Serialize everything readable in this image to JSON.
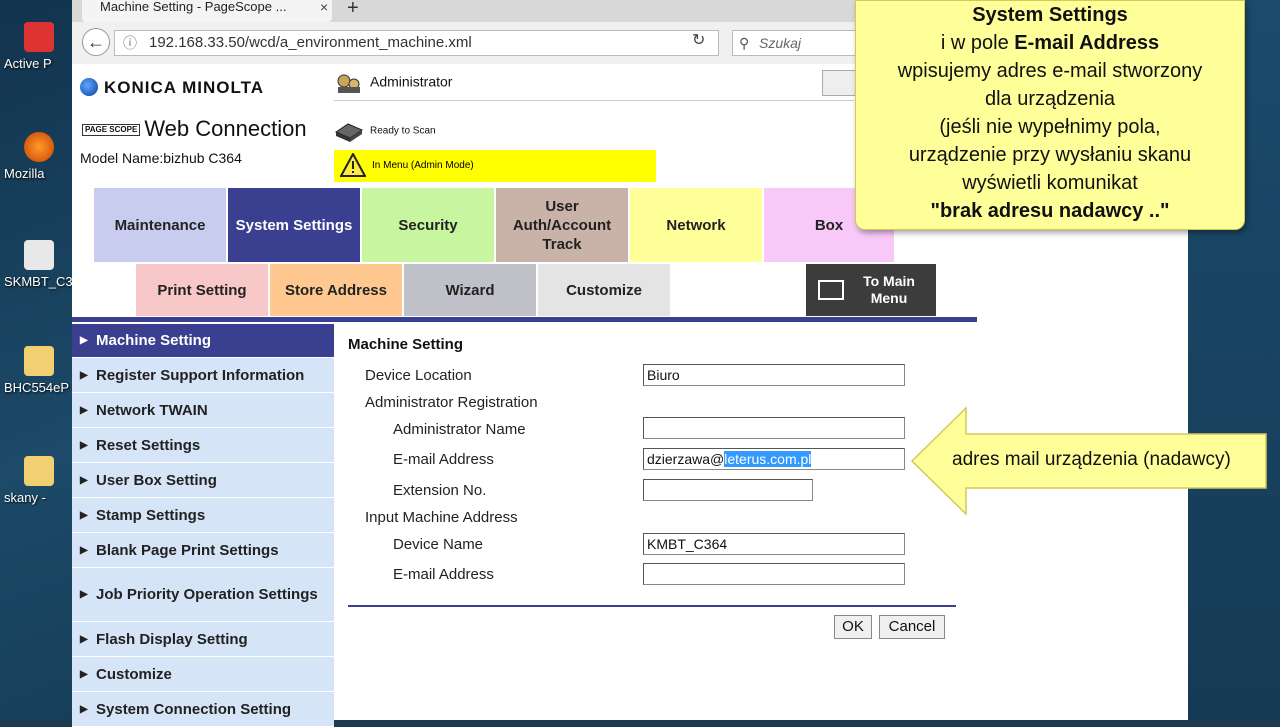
{
  "browser": {
    "tab_title": "Machine Setting - PageScope ...",
    "tab_close": "×",
    "new_tab": "+",
    "url": "192.168.33.50/wcd/a_environment_machine.xml",
    "search_placeholder": "Szukaj"
  },
  "desktop": {
    "icons": [
      {
        "label": "Active P"
      },
      {
        "label": "Mozilla"
      },
      {
        "label": "SKMBT_C3"
      },
      {
        "label": "BHC554eP"
      },
      {
        "label": "skany -"
      }
    ]
  },
  "header": {
    "brand": "KONICA MINOLTA",
    "pagescope": "PAGE SCOPE",
    "product": "Web Connection",
    "model": "Model Name:bizhub C364",
    "user": "Administrator",
    "scan_status": "Ready to Scan",
    "mode_status": "In Menu (Admin Mode)"
  },
  "main_tabs": [
    {
      "label": "Maintenance"
    },
    {
      "label": "System Settings"
    },
    {
      "label": "Security"
    },
    {
      "label": "User Auth/Account Track"
    },
    {
      "label": "Network"
    },
    {
      "label": "Box"
    }
  ],
  "sub_tabs": [
    {
      "label": "Print Setting"
    },
    {
      "label": "Store Address"
    },
    {
      "label": "Wizard"
    },
    {
      "label": "Customize"
    },
    {
      "label": "To Main Menu"
    }
  ],
  "left_menu": [
    {
      "label": "Machine Setting"
    },
    {
      "label": "Register Support Information"
    },
    {
      "label": "Network TWAIN"
    },
    {
      "label": "Reset Settings"
    },
    {
      "label": "User Box Setting"
    },
    {
      "label": "Stamp Settings"
    },
    {
      "label": "Blank Page Print Settings"
    },
    {
      "label": "Job Priority Operation Settings"
    },
    {
      "label": "Flash Display Setting"
    },
    {
      "label": "Customize"
    },
    {
      "label": "System Connection Setting"
    }
  ],
  "form": {
    "title": "Machine Setting",
    "device_location_label": "Device Location",
    "device_location_value": "Biuro",
    "admin_registration_label": "Administrator Registration",
    "admin_name_label": "Administrator Name",
    "admin_name_value": "",
    "email_label": "E-mail Address",
    "email_value_prefix": "dzierzawa@",
    "email_value_selected": "leterus.com.pl",
    "extension_label": "Extension No.",
    "extension_value": "",
    "input_machine_label": "Input Machine Address",
    "device_name_label": "Device Name",
    "device_name_value": "KMBT_C364",
    "machine_email_label": "E-mail Address",
    "machine_email_value": "",
    "ok_label": "OK",
    "cancel_label": "Cancel"
  },
  "annotations": {
    "top_line1": "System Settings",
    "top_line2_prefix": "i w pole ",
    "top_line2_bold": "E-mail Address",
    "top_line3": "wpisujemy adres e-mail stworzony",
    "top_line4": "dla urządzenia",
    "top_line5": "(jeśli nie wypełnimy pola,",
    "top_line6": "urządzenie przy wysłaniu skanu",
    "top_line7": "wyświetli komunikat",
    "top_line8": "\"brak adresu nadawcy ..\"",
    "arrow_text": "adres mail urządzenia (nadawcy)"
  },
  "colors": {
    "nav_blue": "#3b3f8f",
    "menu_light": "#d6e4f7",
    "tab_maintenance": "#c8cdf0",
    "tab_system": "#3b3f8f",
    "tab_security": "#c8f5a0",
    "tab_userauth": "#c9b2a8",
    "tab_network": "#ffff99",
    "tab_box": "#f8c8f8",
    "sub_print": "#f8c8c8",
    "sub_store": "#ffc890",
    "sub_wizard": "#c0c0c8",
    "sub_customize": "#e4e4e4",
    "callout_yellow": "#ffff99",
    "selection": "#3399ff"
  }
}
